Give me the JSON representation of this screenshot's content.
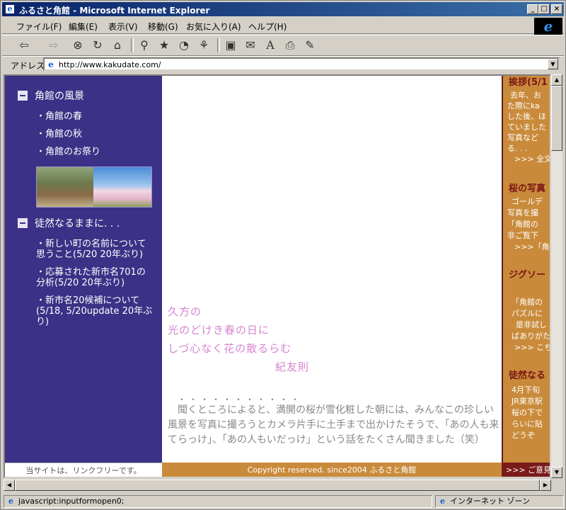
{
  "window": {
    "title": "ふるさと角館 - Microsoft Internet Explorer",
    "brand_icon": "e"
  },
  "menu": [
    "ファイル(F)",
    "編集(E)",
    "表示(V)",
    "移動(G)",
    "お気に入り(A)",
    "ヘルプ(H)"
  ],
  "toolbar": {
    "buttons": [
      "back-icon",
      "forward-icon",
      "stop-icon",
      "refresh-icon",
      "home-icon",
      "search-icon",
      "favorites-icon",
      "history-icon",
      "channels-icon",
      "fullscreen-icon",
      "mail-icon",
      "font-icon",
      "print-icon",
      "edit-icon"
    ]
  },
  "address": {
    "label": "アドレス",
    "url": "http://www.kakudate.com/"
  },
  "left": {
    "section1": "角館の風景",
    "links1": [
      "・角館の春",
      "・角館の秋",
      "・角館のお祭り"
    ],
    "section2": "徒然なるままに. . .",
    "links2": [
      "・新しい町の名前について\n思うこと(5/20 20年ぶり)",
      "・応募された新市名701の\n分析(5/20 20年ぶり)",
      "・新市名20候補について\n(5/18, 5/20update 20年ぶ\nり)"
    ]
  },
  "center": {
    "poem": [
      "久方の",
      "光のどけき春の日に",
      "しづ心なく花の散るらむ"
    ],
    "poet": "紀友則",
    "dots": "・・・・・・・・・・・",
    "story": "　聞くところによると、満開の桜が雪化粧した朝には、みんなこの珍しい風景を写真に撮ろうとカメラ片手に土手まで出かけたそうで、「あの人も来てらっけ」、「あの人もいだっけ」という話をたくさん聞きました（笑）"
  },
  "right": {
    "h1": "挨拶(5/1",
    "t1": [
      "去年、お",
      "た際にka",
      "した後、ほ",
      "ていました",
      "写真など",
      "る. . .",
      ">>> 全文"
    ],
    "h2": "桜の写真",
    "t2": [
      "ゴールデ",
      "写真を撮",
      "「角館の",
      "非ご覧下",
      ">>>「角"
    ],
    "h3": "ジグソー",
    "t3": [
      "「角館の",
      "パズルに",
      "是非試し",
      "ばありがた",
      ">>> こち"
    ],
    "h4": "徒然なる",
    "t4": [
      "4月下旬",
      "JR東京駅",
      "桜の下で",
      "らいに貼",
      "どうぞ"
    ]
  },
  "footer": {
    "left": "当サイトは、リンクフリーです。",
    "center": "Copyright reserved. since2004 ふるさと角館",
    "right": ">>> ご意見"
  },
  "status": {
    "text": "javascript:inputformopen0;",
    "zone": "インターネット ゾーン"
  }
}
